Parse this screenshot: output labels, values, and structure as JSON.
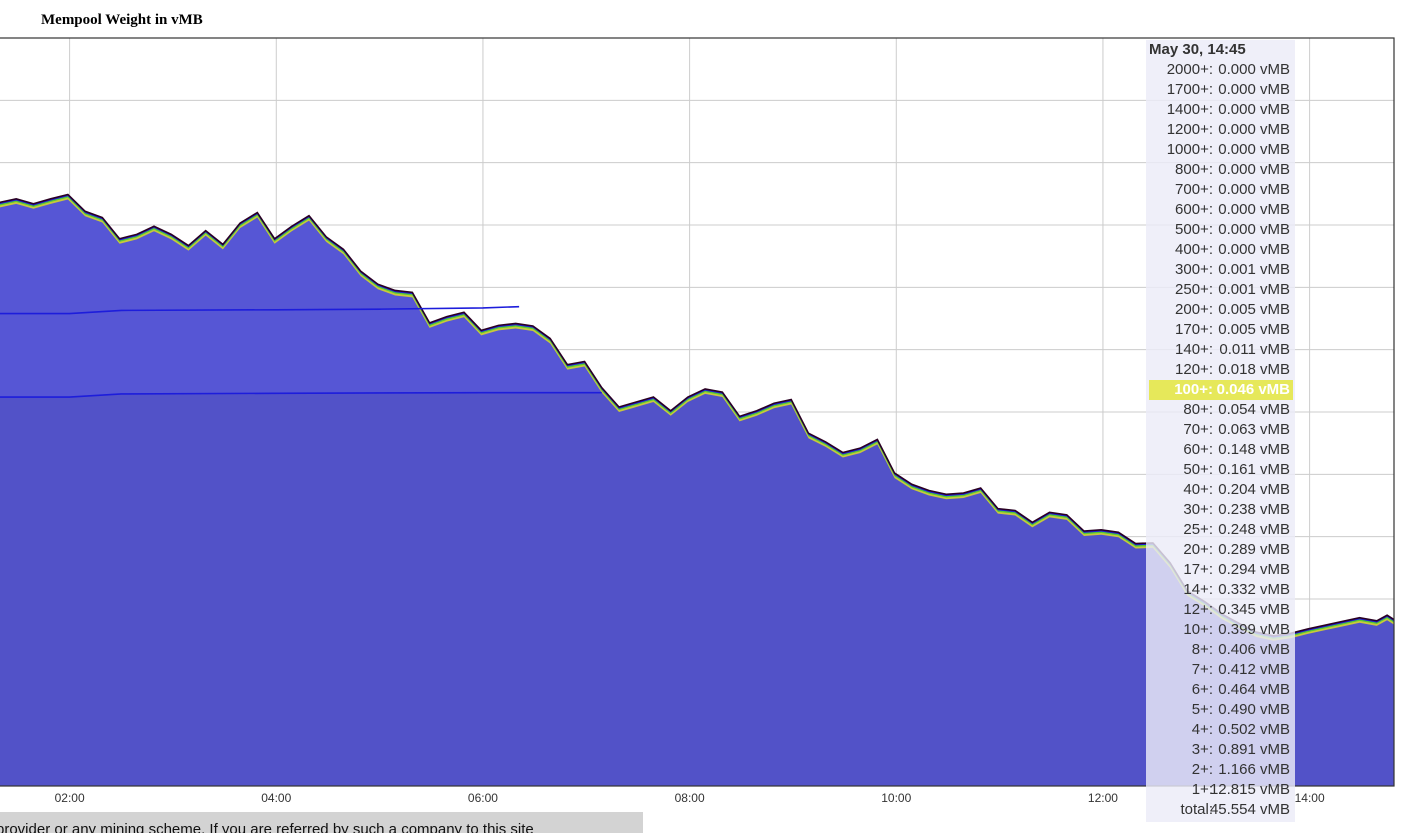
{
  "chart_data": {
    "type": "area",
    "title": "Mempool Weight in vMB",
    "xlabel": "",
    "ylabel": "",
    "x_ticks": [
      "02:00",
      "04:00",
      "06:00",
      "08:00",
      "10:00",
      "12:00",
      "14:00"
    ],
    "x_range": [
      "01:19",
      "14:49"
    ],
    "y_range": [
      0,
      120
    ],
    "grid": true,
    "hover_label": "May 30, 14:45",
    "highlighted_row": "100+:",
    "legend": [
      {
        "label": "2000+:",
        "value": "0.000 vMB"
      },
      {
        "label": "1700+:",
        "value": "0.000 vMB"
      },
      {
        "label": "1400+:",
        "value": "0.000 vMB"
      },
      {
        "label": "1200+:",
        "value": "0.000 vMB"
      },
      {
        "label": "1000+:",
        "value": "0.000 vMB"
      },
      {
        "label": "800+:",
        "value": "0.000 vMB"
      },
      {
        "label": "700+:",
        "value": "0.000 vMB"
      },
      {
        "label": "600+:",
        "value": "0.000 vMB"
      },
      {
        "label": "500+:",
        "value": "0.000 vMB"
      },
      {
        "label": "400+:",
        "value": "0.000 vMB"
      },
      {
        "label": "300+:",
        "value": "0.001 vMB"
      },
      {
        "label": "250+:",
        "value": "0.001 vMB"
      },
      {
        "label": "200+:",
        "value": "0.005 vMB"
      },
      {
        "label": "170+:",
        "value": "0.005 vMB"
      },
      {
        "label": "140+:",
        "value": "0.011 vMB"
      },
      {
        "label": "120+:",
        "value": "0.018 vMB"
      },
      {
        "label": "100+:",
        "value": "0.046 vMB"
      },
      {
        "label": "80+:",
        "value": "0.054 vMB"
      },
      {
        "label": "70+:",
        "value": "0.063 vMB"
      },
      {
        "label": "60+:",
        "value": "0.148 vMB"
      },
      {
        "label": "50+:",
        "value": "0.161 vMB"
      },
      {
        "label": "40+:",
        "value": "0.204 vMB"
      },
      {
        "label": "30+:",
        "value": "0.238 vMB"
      },
      {
        "label": "25+:",
        "value": "0.248 vMB"
      },
      {
        "label": "20+:",
        "value": "0.289 vMB"
      },
      {
        "label": "17+:",
        "value": "0.294 vMB"
      },
      {
        "label": "14+:",
        "value": "0.332 vMB"
      },
      {
        "label": "12+:",
        "value": "0.345 vMB"
      },
      {
        "label": "10+:",
        "value": "0.399 vMB"
      },
      {
        "label": "8+:",
        "value": "0.406 vMB"
      },
      {
        "label": "7+:",
        "value": "0.412 vMB"
      },
      {
        "label": "6+:",
        "value": "0.464 vMB"
      },
      {
        "label": "5+:",
        "value": "0.490 vMB"
      },
      {
        "label": "4+:",
        "value": "0.502 vMB"
      },
      {
        "label": "3+:",
        "value": "0.891 vMB"
      },
      {
        "label": "2+:",
        "value": "1.166 vMB"
      },
      {
        "label": "1+:",
        "value": "12.815 vMB"
      },
      {
        "label": "total:",
        "value": "45.554 vMB"
      }
    ],
    "series_total": [
      [
        "01:19",
        93.6
      ],
      [
        "01:29",
        94.2
      ],
      [
        "01:39",
        93.4
      ],
      [
        "01:49",
        94.2
      ],
      [
        "01:59",
        94.9
      ],
      [
        "02:09",
        92.2
      ],
      [
        "02:19",
        91.2
      ],
      [
        "02:29",
        87.8
      ],
      [
        "02:39",
        88.5
      ],
      [
        "02:49",
        89.8
      ],
      [
        "02:59",
        88.5
      ],
      [
        "03:09",
        86.7
      ],
      [
        "03:19",
        89.1
      ],
      [
        "03:29",
        86.9
      ],
      [
        "03:39",
        90.3
      ],
      [
        "03:49",
        92.0
      ],
      [
        "03:59",
        87.8
      ],
      [
        "04:09",
        89.8
      ],
      [
        "04:19",
        91.5
      ],
      [
        "04:29",
        88.1
      ],
      [
        "04:39",
        86.1
      ],
      [
        "04:49",
        82.6
      ],
      [
        "04:59",
        80.5
      ],
      [
        "05:09",
        79.5
      ],
      [
        "05:19",
        79.2
      ],
      [
        "05:29",
        74.3
      ],
      [
        "05:39",
        75.3
      ],
      [
        "05:49",
        76.0
      ],
      [
        "05:59",
        73.1
      ],
      [
        "06:09",
        73.9
      ],
      [
        "06:19",
        74.2
      ],
      [
        "06:29",
        73.8
      ],
      [
        "06:39",
        71.8
      ],
      [
        "06:49",
        67.6
      ],
      [
        "06:59",
        68.1
      ],
      [
        "07:09",
        63.9
      ],
      [
        "07:19",
        60.8
      ],
      [
        "07:29",
        61.6
      ],
      [
        "07:39",
        62.4
      ],
      [
        "07:49",
        60.2
      ],
      [
        "07:59",
        62.4
      ],
      [
        "08:09",
        63.7
      ],
      [
        "08:19",
        63.2
      ],
      [
        "08:29",
        59.3
      ],
      [
        "08:39",
        60.2
      ],
      [
        "08:49",
        61.4
      ],
      [
        "08:59",
        62.0
      ],
      [
        "09:09",
        56.6
      ],
      [
        "09:19",
        55.2
      ],
      [
        "09:29",
        53.5
      ],
      [
        "09:39",
        54.2
      ],
      [
        "09:49",
        55.6
      ],
      [
        "09:59",
        50.2
      ],
      [
        "10:09",
        48.4
      ],
      [
        "10:19",
        47.4
      ],
      [
        "10:29",
        46.8
      ],
      [
        "10:39",
        47.0
      ],
      [
        "10:49",
        47.8
      ],
      [
        "10:59",
        44.5
      ],
      [
        "11:09",
        44.2
      ],
      [
        "11:19",
        42.3
      ],
      [
        "11:29",
        43.9
      ],
      [
        "11:39",
        43.5
      ],
      [
        "11:49",
        40.9
      ],
      [
        "11:59",
        41.1
      ],
      [
        "12:09",
        40.7
      ],
      [
        "12:19",
        38.9
      ],
      [
        "12:29",
        39.0
      ],
      [
        "12:39",
        35.8
      ],
      [
        "12:49",
        31.3
      ],
      [
        "12:59",
        29.6
      ],
      [
        "13:09",
        27.6
      ],
      [
        "13:19",
        26.1
      ],
      [
        "13:29",
        24.7
      ],
      [
        "13:39",
        24.1
      ],
      [
        "13:49",
        24.5
      ],
      [
        "13:59",
        25.2
      ],
      [
        "14:09",
        25.8
      ],
      [
        "14:19",
        26.4
      ],
      [
        "14:29",
        27.0
      ],
      [
        "14:39",
        26.5
      ],
      [
        "14:45",
        27.4
      ],
      [
        "14:49",
        26.7
      ]
    ],
    "series_base_line": [
      [
        "01:19",
        75.8
      ],
      [
        "02:00",
        75.8
      ],
      [
        "02:30",
        76.3
      ],
      [
        "04:00",
        76.4
      ],
      [
        "05:00",
        76.5
      ],
      [
        "06:00",
        76.7
      ],
      [
        "06:21",
        76.9
      ]
    ],
    "series_low_line": [
      [
        "01:19",
        62.4
      ],
      [
        "02:00",
        62.4
      ],
      [
        "02:30",
        62.9
      ],
      [
        "04:00",
        63.0
      ],
      [
        "06:00",
        63.1
      ],
      [
        "07:00",
        63.1
      ],
      [
        "07:09",
        63.1
      ]
    ],
    "colors": {
      "fill_main": "#5252c8",
      "fill_upper": "#5a5ae0",
      "band_yellow": "#c8c83c",
      "band_green": "#55cc33",
      "band_blue": "#1d1ddb",
      "outline": "#2a0022",
      "grid": "#cccccc",
      "border": "#333333"
    }
  },
  "footer": {
    "text": "provider or any mining scheme. If you are referred by such a company to this site"
  }
}
